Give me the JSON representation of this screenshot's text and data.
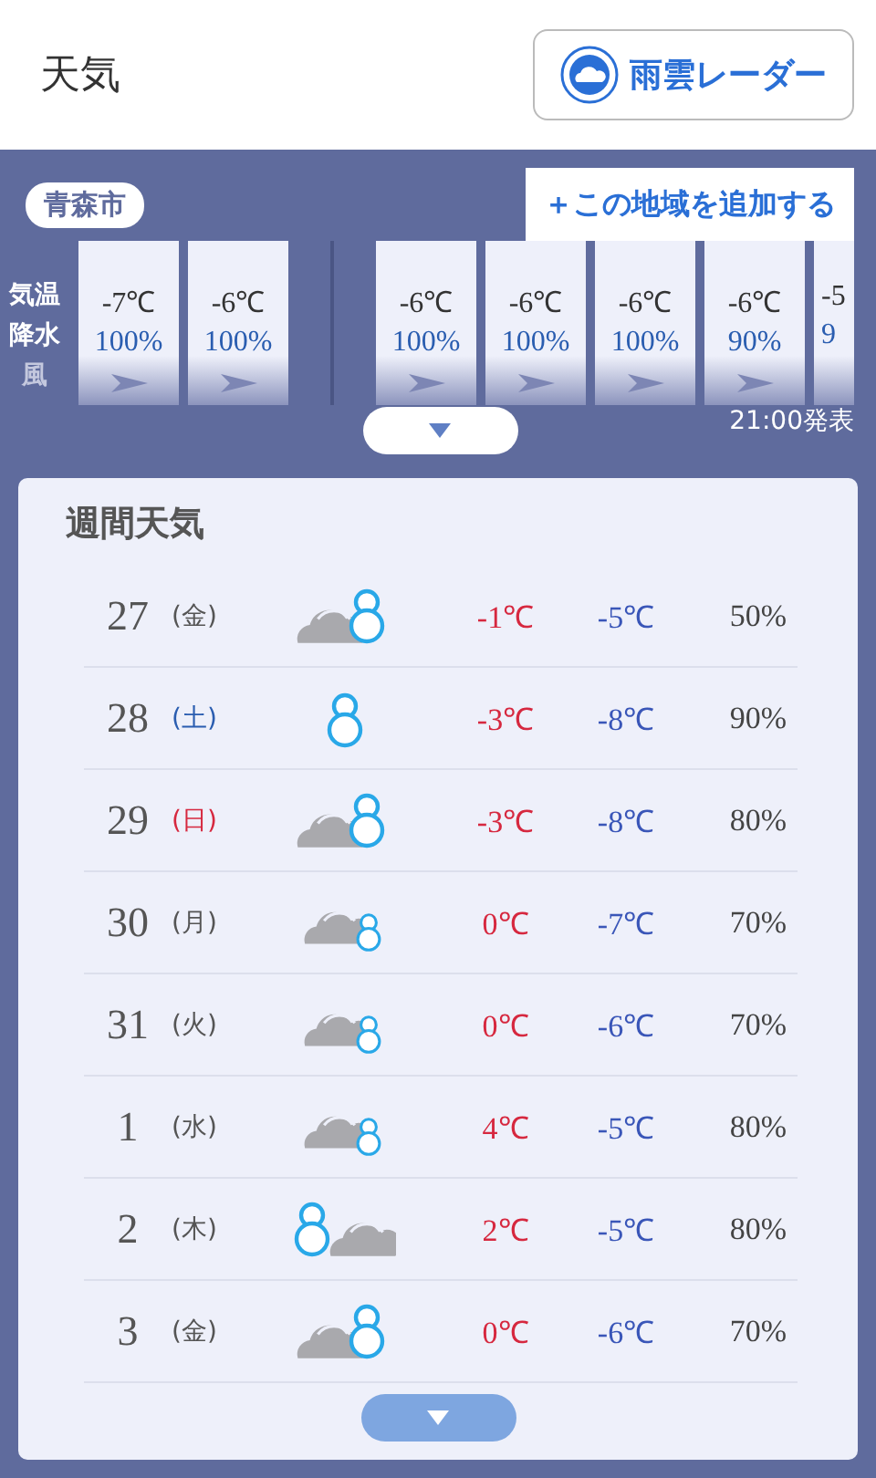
{
  "header": {
    "title": "天気",
    "radar_button": "雨雲レーダー"
  },
  "location": {
    "name": "青森市",
    "add_button": "＋この地域を追加する"
  },
  "hourly": {
    "row_labels": [
      "気温",
      "降水",
      "風"
    ],
    "groups": [
      [
        {
          "temp": "-7℃",
          "precip": "100%"
        },
        {
          "temp": "-6℃",
          "precip": "100%"
        }
      ],
      [
        {
          "temp": "-6℃",
          "precip": "100%"
        },
        {
          "temp": "-6℃",
          "precip": "100%"
        },
        {
          "temp": "-6℃",
          "precip": "100%"
        },
        {
          "temp": "-6℃",
          "precip": "90%"
        },
        {
          "temp": "-5",
          "precip": "9",
          "cut": true
        }
      ]
    ],
    "issued": "21:00発表"
  },
  "weekly": {
    "title": "週間天気",
    "days": [
      {
        "date": "27",
        "weekday": "(金)",
        "color": "#555555",
        "kind": "cloudsnow",
        "high": "-1℃",
        "low": "-5℃",
        "precip": "50%"
      },
      {
        "date": "28",
        "weekday": "(土)",
        "color": "#2a5db0",
        "kind": "snow",
        "high": "-3℃",
        "low": "-8℃",
        "precip": "90%"
      },
      {
        "date": "29",
        "weekday": "(日)",
        "color": "#d6283f",
        "kind": "cloudsnow",
        "high": "-3℃",
        "low": "-8℃",
        "precip": "80%"
      },
      {
        "date": "30",
        "weekday": "(月)",
        "color": "#555555",
        "kind": "cloudsmallsnow",
        "high": "0℃",
        "low": "-7℃",
        "precip": "70%"
      },
      {
        "date": "31",
        "weekday": "(火)",
        "color": "#555555",
        "kind": "cloudsmallsnow",
        "high": "0℃",
        "low": "-6℃",
        "precip": "70%"
      },
      {
        "date": "1",
        "weekday": "(水)",
        "color": "#555555",
        "kind": "cloudsmallsnow",
        "high": "4℃",
        "low": "-5℃",
        "precip": "80%"
      },
      {
        "date": "2",
        "weekday": "(木)",
        "color": "#555555",
        "kind": "snowcloud",
        "high": "2℃",
        "low": "-5℃",
        "precip": "80%"
      },
      {
        "date": "3",
        "weekday": "(金)",
        "color": "#555555",
        "kind": "cloudsnow",
        "high": "0℃",
        "low": "-6℃",
        "precip": "70%"
      }
    ]
  }
}
